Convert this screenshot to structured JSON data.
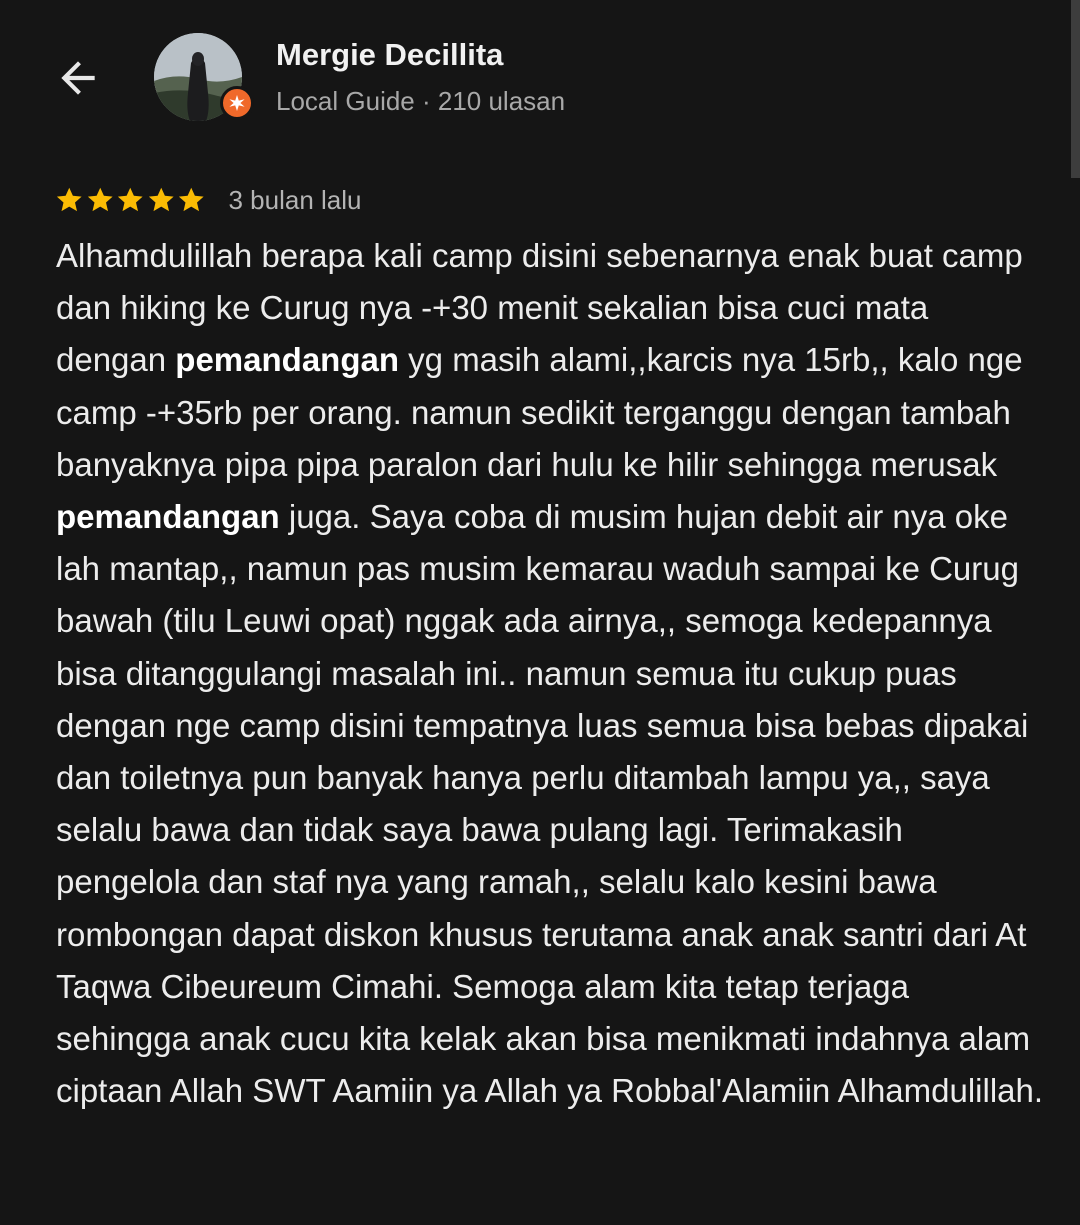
{
  "header": {
    "user_name": "Mergie Decillita",
    "user_meta": "Local Guide · 210 ulasan",
    "icons": {
      "back": "arrow-back-icon",
      "badge": "local-guide-badge-icon"
    },
    "colors": {
      "background": "#151515",
      "badge": "#f0692a",
      "star": "#fbbc04"
    }
  },
  "review": {
    "rating": 5,
    "rating_max": 5,
    "date": "3 bulan lalu",
    "segments": [
      {
        "text": "Alhamdulillah berapa kali camp disini sebenarnya enak buat camp dan hiking ke Curug nya -+30 menit sekalian bisa cuci mata dengan ",
        "bold": false
      },
      {
        "text": "pemandangan",
        "bold": true
      },
      {
        "text": " yg masih alami,,karcis nya 15rb,, kalo nge camp -+35rb per orang. namun sedikit terganggu dengan tambah banyaknya pipa pipa paralon dari hulu ke hilir sehingga merusak ",
        "bold": false
      },
      {
        "text": "pemandangan",
        "bold": true
      },
      {
        "text": " juga. Saya coba di musim hujan debit air nya oke lah mantap,, namun pas musim kemarau waduh sampai ke Curug bawah (tilu Leuwi opat) nggak ada airnya,, semoga kedepannya bisa ditanggulangi masalah ini.. namun semua itu cukup puas dengan nge camp disini tempatnya luas semua bisa bebas dipakai dan toiletnya pun banyak hanya perlu ditambah lampu ya,, saya selalu bawa dan tidak saya bawa pulang lagi. Terimakasih pengelola dan staf nya yang ramah,, selalu kalo kesini bawa rombongan dapat diskon khusus terutama anak anak santri dari At Taqwa Cibeureum Cimahi. Semoga alam kita tetap terjaga sehingga anak cucu kita kelak akan bisa menikmati indahnya alam ciptaan Allah SWT Aamiin ya Allah ya Robbal'Alamiin Alhamdulillah.",
        "bold": false
      }
    ]
  }
}
